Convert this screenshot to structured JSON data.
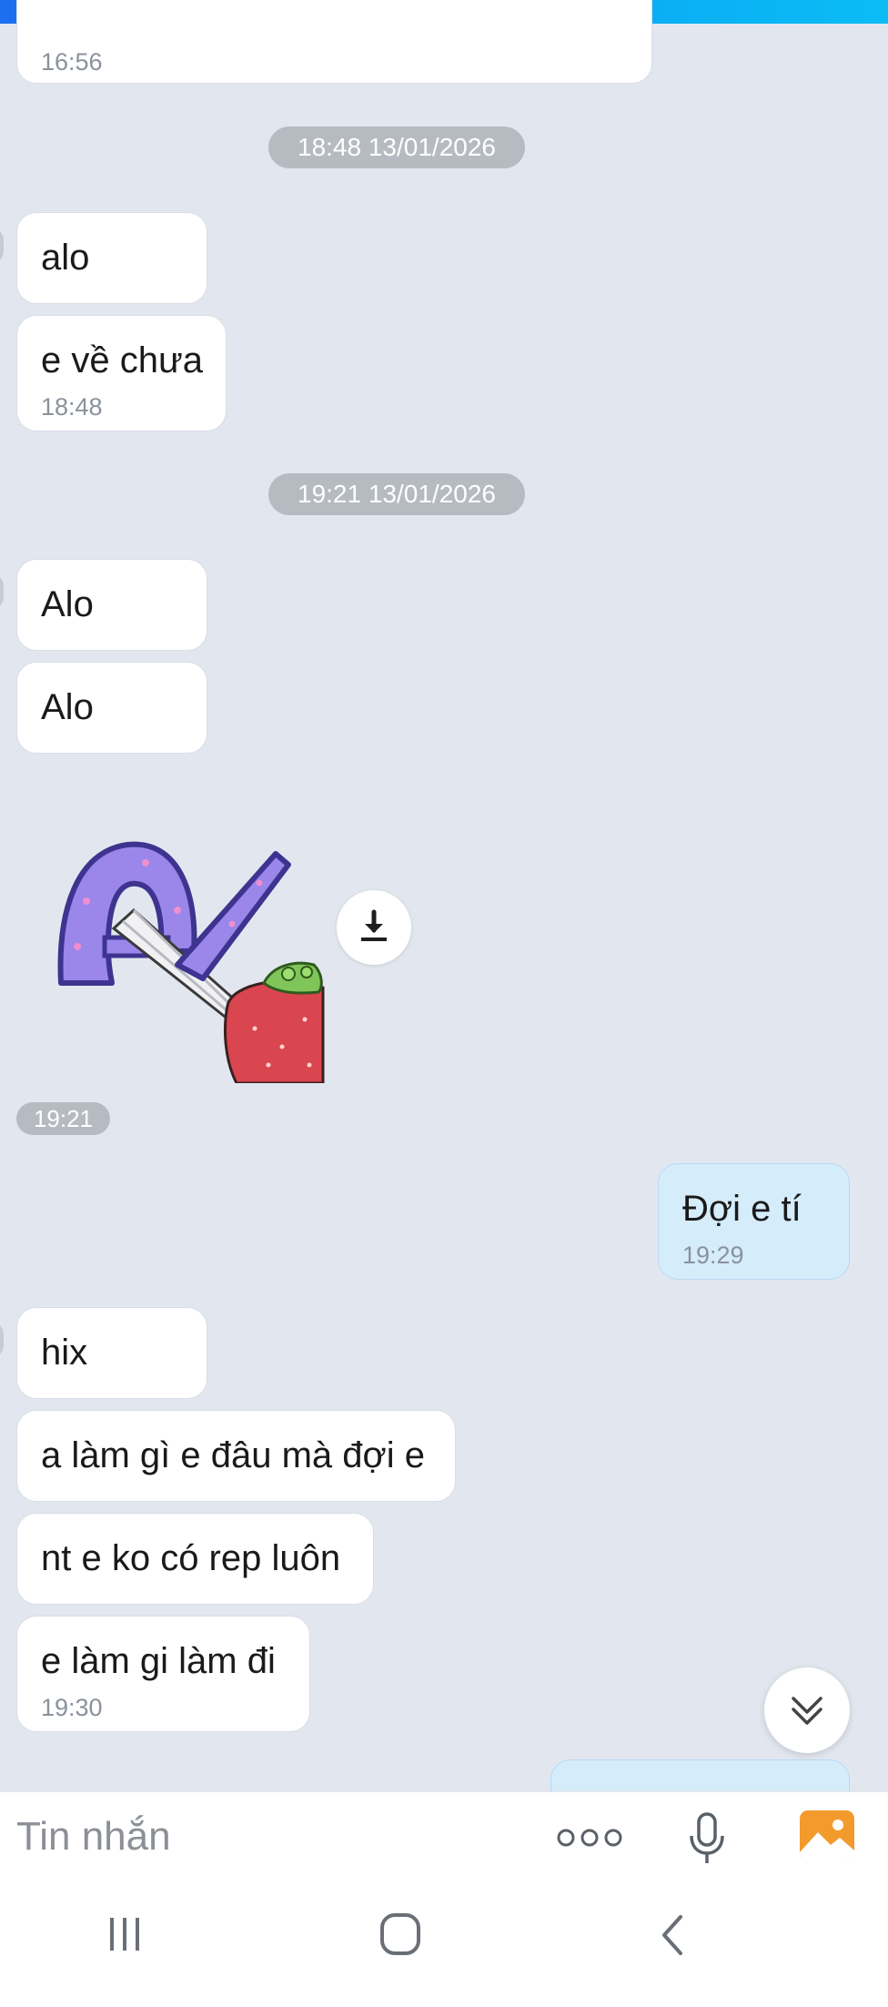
{
  "messages": {
    "top_time": "16:56",
    "date1": "18:48 13/01/2026",
    "m1": "alo",
    "m2": "e về chưa",
    "m2_time": "18:48",
    "date2": "19:21 13/01/2026",
    "m3": "Alo",
    "m4": "Alo",
    "sticker_time": "19:21",
    "m5": "Đợi e tí",
    "m5_time": "19:29",
    "m6": "hix",
    "m7": "a làm gì e đâu mà đợi e",
    "m8": "nt e ko có rep luôn",
    "m9": "e làm gi làm đi",
    "m9_time": "19:30"
  },
  "composer": {
    "placeholder": "Tin nhắn",
    "more_icon": "more-dots-icon",
    "mic_icon": "microphone-icon",
    "image_icon": "gallery-icon"
  },
  "navbar": {
    "recents_icon": "recents-icon",
    "home_icon": "home-icon",
    "back_icon": "back-icon"
  },
  "colors": {
    "background": "#e2e7ef",
    "outgoing_bubble": "#d5ecfb",
    "accent": "#0aa8f2",
    "gallery_orange": "#f39a2c"
  }
}
